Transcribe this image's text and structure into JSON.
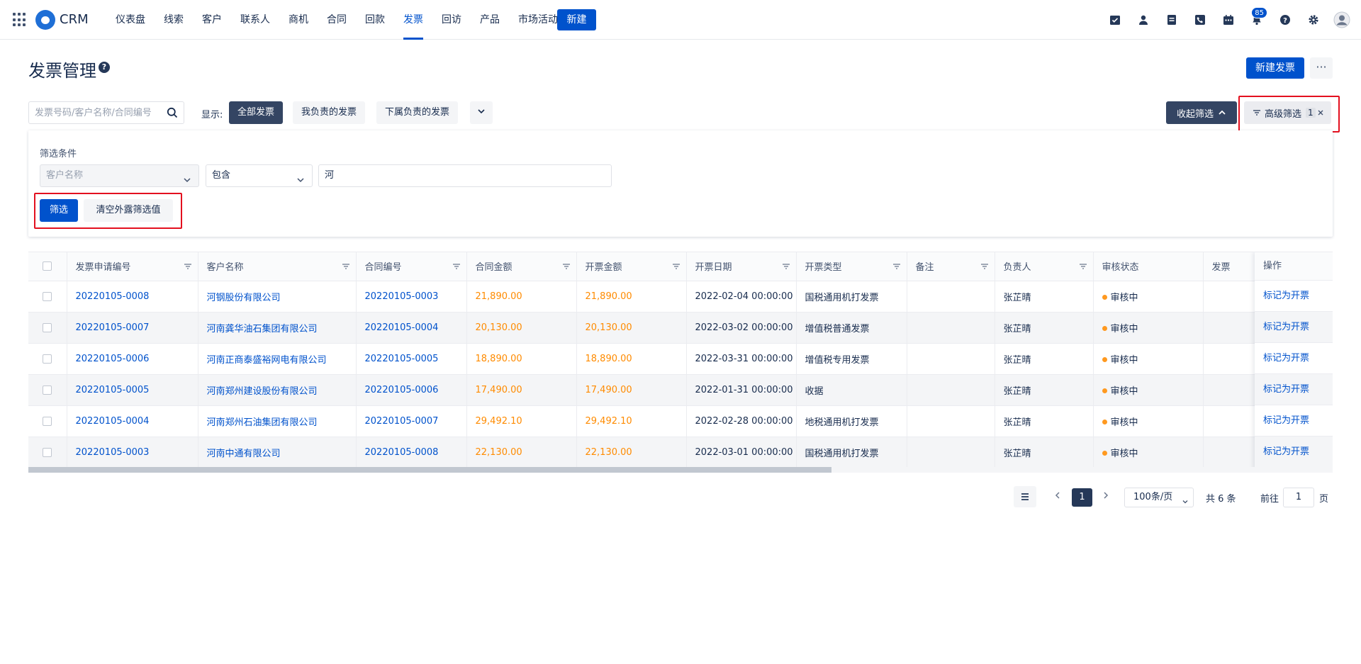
{
  "nav": {
    "brand": "CRM",
    "items": [
      {
        "label": "仪表盘"
      },
      {
        "label": "线索"
      },
      {
        "label": "客户"
      },
      {
        "label": "联系人"
      },
      {
        "label": "商机"
      },
      {
        "label": "合同"
      },
      {
        "label": "回款"
      },
      {
        "label": "发票",
        "active": true
      },
      {
        "label": "回访"
      },
      {
        "label": "产品"
      },
      {
        "label": "市场活动"
      }
    ],
    "new_label": "新建",
    "notification_count": "85",
    "icons": [
      "task-icon",
      "contact-icon",
      "note-icon",
      "phone-icon",
      "calendar-icon",
      "bell-icon",
      "help-icon",
      "settings-icon",
      "avatar-icon"
    ]
  },
  "header": {
    "title": "发票管理",
    "help_glyph": "?",
    "create_label": "新建发票",
    "more_label": "···"
  },
  "filterbar": {
    "search_placeholder": "发票号码/客户名称/合同编号",
    "show_label": "显示:",
    "segments": [
      "全部发票",
      "我负责的发票",
      "下属负责的发票"
    ],
    "collapse_label": "收起筛选",
    "advanced_label": "高级筛选",
    "advanced_count": "1"
  },
  "filter_panel": {
    "title": "筛选条件",
    "field_placeholder": "客户名称",
    "operator": "包含",
    "value": "河",
    "filter_label": "筛选",
    "clear_label": "清空外露筛选值"
  },
  "table": {
    "columns": [
      "发票申请编号",
      "客户名称",
      "合同编号",
      "合同金额",
      "开票金额",
      "开票日期",
      "开票类型",
      "备注",
      "负责人",
      "审核状态",
      "发票"
    ],
    "op_header": "操作",
    "rows": [
      {
        "no": "20220105-0008",
        "customer": "河钢股份有限公司",
        "contract": "20220105-0003",
        "contract_amt": "21,890.00",
        "invoice_amt": "21,890.00",
        "date": "2022-02-04 00:00:00",
        "type": "国税通用机打发票",
        "remark": "",
        "owner": "张芷晴",
        "status": "审核中",
        "op": "标记为开票"
      },
      {
        "no": "20220105-0007",
        "customer": "河南龚华油石集团有限公司",
        "contract": "20220105-0004",
        "contract_amt": "20,130.00",
        "invoice_amt": "20,130.00",
        "date": "2022-03-02 00:00:00",
        "type": "增值税普通发票",
        "remark": "",
        "owner": "张芷晴",
        "status": "审核中",
        "op": "标记为开票"
      },
      {
        "no": "20220105-0006",
        "customer": "河南正商泰盛裕网电有限公司",
        "contract": "20220105-0005",
        "contract_amt": "18,890.00",
        "invoice_amt": "18,890.00",
        "date": "2022-03-31 00:00:00",
        "type": "增值税专用发票",
        "remark": "",
        "owner": "张芷晴",
        "status": "审核中",
        "op": "标记为开票"
      },
      {
        "no": "20220105-0005",
        "customer": "河南郑州建设股份有限公司",
        "contract": "20220105-0006",
        "contract_amt": "17,490.00",
        "invoice_amt": "17,490.00",
        "date": "2022-01-31 00:00:00",
        "type": "收据",
        "remark": "",
        "owner": "张芷晴",
        "status": "审核中",
        "op": "标记为开票"
      },
      {
        "no": "20220105-0004",
        "customer": "河南郑州石油集团有限公司",
        "contract": "20220105-0007",
        "contract_amt": "29,492.10",
        "invoice_amt": "29,492.10",
        "date": "2022-02-28 00:00:00",
        "type": "地税通用机打发票",
        "remark": "",
        "owner": "张芷晴",
        "status": "审核中",
        "op": "标记为开票"
      },
      {
        "no": "20220105-0003",
        "customer": "河南中通有限公司",
        "contract": "20220105-0008",
        "contract_amt": "22,130.00",
        "invoice_amt": "22,130.00",
        "date": "2022-03-01 00:00:00",
        "type": "国税通用机打发票",
        "remark": "",
        "owner": "张芷晴",
        "status": "审核中",
        "op": "标记为开票"
      }
    ]
  },
  "pagination": {
    "current": "1",
    "page_size": "100条/页",
    "total": "共 6 条",
    "goto_label": "前往",
    "goto_value": "1",
    "page_suffix": "页"
  },
  "colors": {
    "primary": "#0052cc",
    "dark": "#344563",
    "amount": "#ff8b00",
    "status_dot": "#ff991f",
    "highlight": "#e3101f"
  }
}
